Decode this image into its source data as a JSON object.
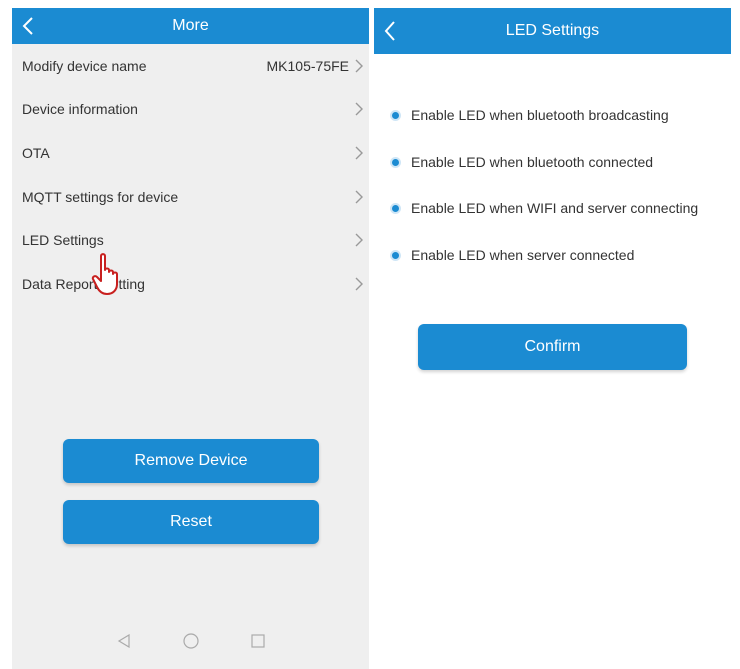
{
  "left": {
    "header": {
      "title": "More",
      "back_icon": "chevron-left-icon"
    },
    "items": [
      {
        "label": "Modify device name",
        "value": "MK105-75FE"
      },
      {
        "label": "Device information"
      },
      {
        "label": "OTA"
      },
      {
        "label": "MQTT settings for device"
      },
      {
        "label": "LED Settings"
      },
      {
        "label": "Data Report Setting"
      }
    ],
    "buttons": {
      "remove": "Remove Device",
      "reset": "Reset"
    },
    "navbar": [
      "back-triangle-icon",
      "home-circle-icon",
      "recents-square-icon"
    ]
  },
  "right": {
    "header": {
      "title": "LED Settings",
      "back_icon": "chevron-left-icon"
    },
    "options": [
      {
        "label": "Enable LED when bluetooth broadcasting",
        "enabled": true
      },
      {
        "label": "Enable LED when bluetooth connected",
        "enabled": true
      },
      {
        "label": "Enable LED when WIFI and server connecting",
        "enabled": true
      },
      {
        "label": "Enable LED when server connected",
        "enabled": true
      }
    ],
    "confirm": "Confirm"
  },
  "colors": {
    "accent": "#1b8bd2",
    "left_bg": "#efefef",
    "cursor": "#c8201f"
  }
}
